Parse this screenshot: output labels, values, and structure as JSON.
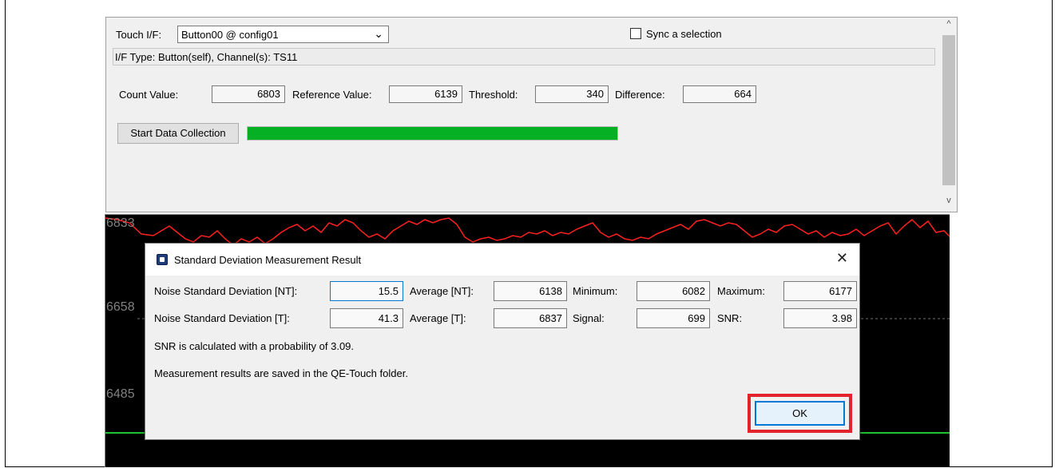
{
  "touch_panel": {
    "touch_if_label": "Touch I/F:",
    "touch_if_value": "Button00 @ config01",
    "sync_label": "Sync a selection",
    "if_type_text": "I/F Type: Button(self), Channel(s): TS11",
    "count_label": "Count Value:",
    "count_value": "6803",
    "reference_label": "Reference Value:",
    "reference_value": "6139",
    "threshold_label": "Threshold:",
    "threshold_value": "340",
    "difference_label": "Difference:",
    "difference_value": "664",
    "start_button_label": "Start Data Collection",
    "progress_fraction": 1.0,
    "progress_color": "#06b025"
  },
  "graph": {
    "y_labels": [
      "6833",
      "6658",
      "6485"
    ],
    "count_line_color": "#ff2020",
    "threshold_line_color": "#22c030"
  },
  "dialog": {
    "title": "Standard Deviation Measurement Result",
    "close_symbol": "✕",
    "row1": {
      "noise_label": "Noise Standard Deviation [NT]:",
      "noise_value": "15.5",
      "average_label": "Average [NT]:",
      "average_value": "6138",
      "min_label": "Minimum:",
      "min_value": "6082",
      "max_label": "Maximum:",
      "max_value": "6177"
    },
    "row2": {
      "noise_label": "Noise Standard Deviation [T]:",
      "noise_value": "41.3",
      "average_label": "Average [T]:",
      "average_value": "6837",
      "signal_label": "Signal:",
      "signal_value": "699",
      "snr_label": "SNR:",
      "snr_value": "3.98"
    },
    "snr_note": "SNR is calculated with a probability of 3.09.",
    "saved_note": "Measurement results are saved in the QE-Touch folder.",
    "ok_label": "OK",
    "highlight_color": "#e3232b"
  }
}
